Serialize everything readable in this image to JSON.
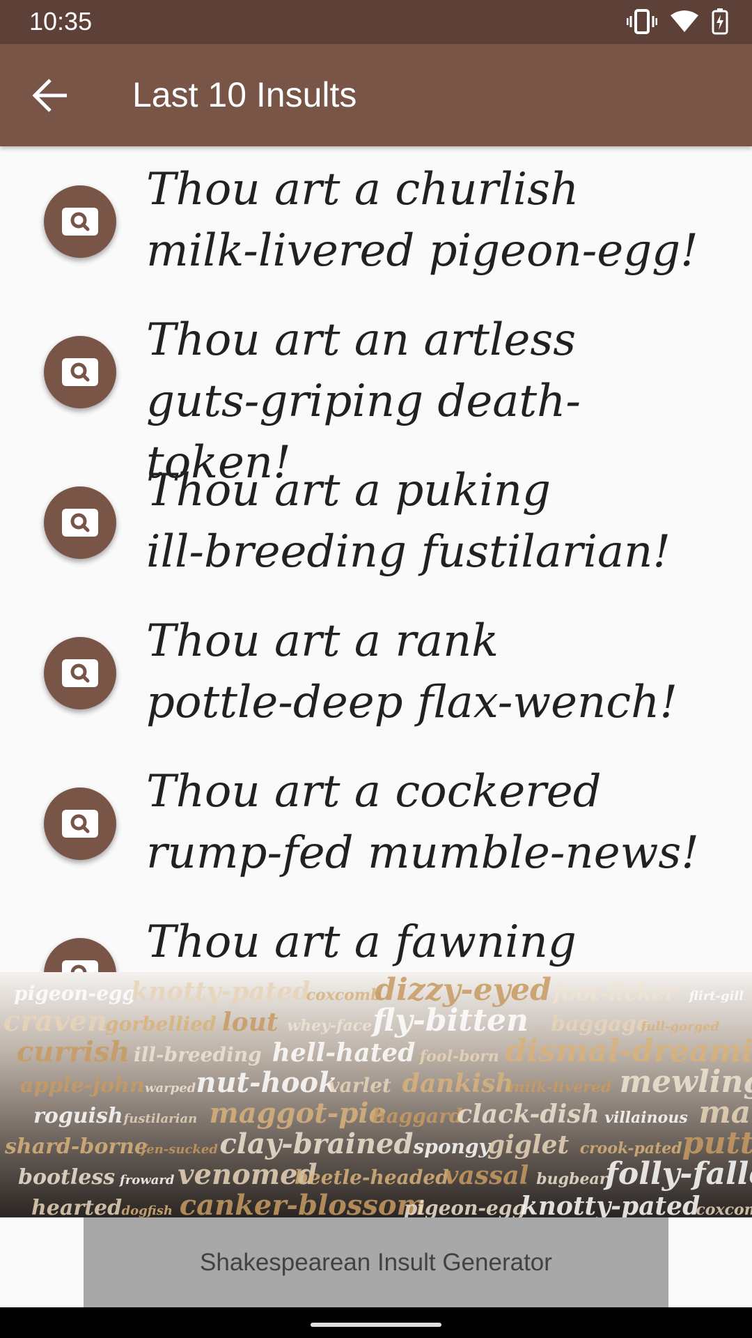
{
  "status_bar": {
    "time": "10:35",
    "icons": [
      "vibrate-icon",
      "wifi-icon",
      "battery-charging-icon"
    ]
  },
  "app_bar": {
    "title": "Last 10 Insults",
    "back_icon": "arrow-back-icon"
  },
  "insults": [
    {
      "line1": "Thou art a churlish",
      "line2": "milk-livered pigeon-egg!"
    },
    {
      "line1": "Thou art an artless",
      "line2": "guts-griping death-token!"
    },
    {
      "line1": "Thou art a puking",
      "line2": "ill-breeding fustilarian!"
    },
    {
      "line1": "Thou art a rank",
      "line2": "pottle-deep flax-wench!"
    },
    {
      "line1": "Thou art a cockered",
      "line2": "rump-fed mumble-news!"
    },
    {
      "line1": "Thou art a fawning",
      "line2": ""
    }
  ],
  "row_action_icon": "search-icon",
  "wordcloud": {
    "words": [
      "pigeon-egg",
      "knotty-pated",
      "coxcomb",
      "dizzy-eyed",
      "foot-licker",
      "flirt-gill",
      "craven",
      "gorbellied",
      "lout",
      "whey-face",
      "fly-bitten",
      "baggage",
      "full-gorged",
      "currish",
      "ill-breeding",
      "hell-hated",
      "fool-born",
      "dismal-dreaming",
      "apple-john",
      "warped",
      "nut-hook",
      "varlet",
      "dankish",
      "milk-livered",
      "mewling",
      "roguish",
      "fustilarian",
      "maggot-pie",
      "haggard",
      "clack-dish",
      "villainous",
      "mammet",
      "shard-borne",
      "fen-sucked",
      "clay-brained",
      "spongy",
      "giglet",
      "crook-pated",
      "puttock",
      "bootless",
      "froward",
      "venomed",
      "beetle-headed",
      "vassal",
      "bugbear",
      "folly-fallen",
      "hearted",
      "dogfish",
      "canker-blossom"
    ],
    "colors": [
      "#ffffff",
      "#e8d5b9",
      "#d9b27a",
      "#c89b62",
      "#f0e4d2"
    ]
  },
  "banner": {
    "label": "Shakespearean Insult Generator"
  },
  "colors": {
    "status_bar": "#5d4037",
    "app_bar": "#795548",
    "fab": "#795548",
    "banner": "#a8a8a8"
  }
}
